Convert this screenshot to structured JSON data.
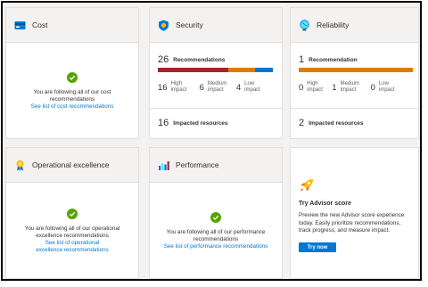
{
  "cost": {
    "title": "Cost",
    "message": "You are following all of our cost recommendations",
    "link": "See list of cost recommendations"
  },
  "security": {
    "title": "Security",
    "rec_count": "26",
    "rec_label": "Recommendations",
    "bar_fractions": {
      "high": 0.615,
      "medium": 0.231,
      "low": 0.154
    },
    "impacts": [
      {
        "count": "16",
        "label1": "High",
        "label2": "impact"
      },
      {
        "count": "6",
        "label1": "Medium",
        "label2": "impact"
      },
      {
        "count": "4",
        "label1": "Low",
        "label2": "impact"
      }
    ],
    "impacted_count": "16",
    "impacted_label": "Impacted resources"
  },
  "reliability": {
    "title": "Reliability",
    "rec_count": "1",
    "rec_label": "Recommendation",
    "bar_fractions": {
      "high": 0,
      "medium": 1,
      "low": 0
    },
    "impacts": [
      {
        "count": "0",
        "label1": "High",
        "label2": "impact"
      },
      {
        "count": "1",
        "label1": "Medium",
        "label2": "impact"
      },
      {
        "count": "0",
        "label1": "Low",
        "label2": "impact"
      }
    ],
    "impacted_count": "2",
    "impacted_label": "Impacted resources"
  },
  "operational": {
    "title": "Operational excellence",
    "message": "You are following all of our operational excellence recommendations",
    "link": "See list of operational excellence recommendations"
  },
  "performance": {
    "title": "Performance",
    "message": "You are following all of our performance recommendations",
    "link": "See list of performance recommendations"
  },
  "advisor": {
    "title": "Try Advisor score",
    "description": "Preview the new Advisor score experience today. Easily prioritize recommendations, track progress, and measure impact.",
    "button": "Try now"
  },
  "colors": {
    "high": "#a4262c",
    "medium": "#e07a00",
    "low": "#0078d4",
    "success": "#57a300"
  }
}
